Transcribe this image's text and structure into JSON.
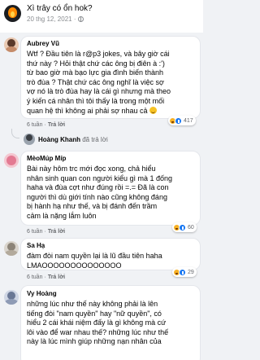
{
  "post": {
    "title": "Xì trây có ổn hok?",
    "time": "20 thg 12, 2021 ·"
  },
  "comments": [
    {
      "name": "Aubrey Vũ",
      "lines": [
        "Wtf ? Đầu tiên là r@p3 jokes, và bây giờ cái",
        "thứ này ? Hỏi thật chứ các ông bị điên à :')",
        "từ bao giờ mà bạo lực gia đình biến thành",
        "trò đùa ? Thật chứ các ông nghĩ là việc sợ",
        "vợ nó là trò đùa hay là cái gì nhưng mà theo",
        "ý kiến cá nhân thì tôi thấy là trong một mối",
        "quan hệ thì không ai phải sợ nhau cả"
      ],
      "time": "6 tuần",
      "reply": "Trả lời",
      "reaction_count": "417"
    },
    {
      "name": "Hoàng Khanh",
      "lines": [],
      "time": "",
      "reply": "đã trả lời",
      "reaction_count": ""
    },
    {
      "name": "MèoMúp Míp",
      "lines": [
        "Bài này hôm trc mới đọc xong, chả hiểu",
        "nhân sinh quan con người kiểu gì mà 1 đống",
        "haha và đùa cợt như đúng rồi =.= Đã là con",
        "người thì dù giới tính nào cũng không đáng",
        "bị hành hạ như thế, và bị đánh đến trầm",
        "cảm là nặng lắm luôn"
      ],
      "time": "6 tuần",
      "reply": "Trả lời",
      "reaction_count": "60"
    },
    {
      "name": "Sa Hạ",
      "lines": [
        "đàm đòi nam quyền lại là lũ đầu tiên haha",
        "LMAOOOOOOOOOOOOOO"
      ],
      "time": "6 tuần",
      "reply": "Trả lời",
      "reaction_count": "29"
    },
    {
      "name": "Vy Hoàng",
      "lines": [
        "những lúc như thế này không phải là lên",
        "tiếng đòi \"nam quyền\" hay \"nữ quyền\", có",
        "hiểu 2 cái khái niệm đấy là gì không mà cứ",
        "lôi vào để war nhau thế? những lúc như thế",
        "này là lúc mình giúp những nạn nhân của"
      ],
      "time": "",
      "reply": "",
      "reaction_count": ""
    }
  ],
  "colors": {
    "background": "#f0f2f5",
    "bubble": "#ffffff",
    "meta_text": "#65676b",
    "like_blue": "#1877f2",
    "haha_yellow": "#f7b125"
  }
}
